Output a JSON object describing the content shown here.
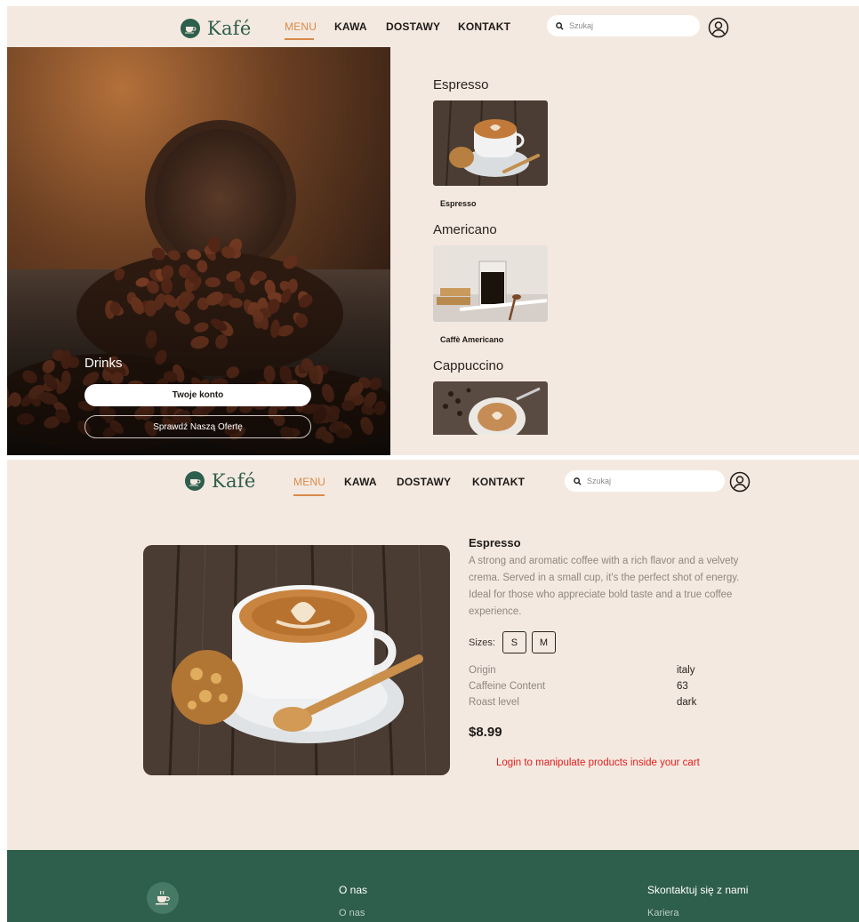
{
  "brand": {
    "name": "Kafé"
  },
  "nav": {
    "items": [
      {
        "label": "MENU",
        "active": true
      },
      {
        "label": "KAWA"
      },
      {
        "label": "DOSTAWY"
      },
      {
        "label": "KONTAKT"
      }
    ],
    "search_placeholder": "Szukaj"
  },
  "hero": {
    "title": "Drinks",
    "primary_button": "Twoje konto",
    "secondary_button": "Sprawdź Naszą Ofertę"
  },
  "menu": {
    "sections": [
      {
        "heading": "Espresso",
        "caption": "Espresso"
      },
      {
        "heading": "Americano",
        "caption": "Caffè Americano"
      },
      {
        "heading": "Cappuccino"
      }
    ]
  },
  "product": {
    "name": "Espresso",
    "description": "A strong and aromatic coffee with a rich flavor and a velvety crema. Served in a small cup, it's the perfect shot of energy. Ideal for those who appreciate bold taste and a true coffee experience.",
    "sizes_label": "Sizes:",
    "sizes": [
      "S",
      "M"
    ],
    "specs": [
      {
        "label": "Origin",
        "value": "italy"
      },
      {
        "label": "Caffeine Content",
        "value": "63"
      },
      {
        "label": "Roast level",
        "value": "dark"
      }
    ],
    "price": "$8.99",
    "login_note": "Login to manipulate products inside your cart"
  },
  "footer": {
    "col1_heading": "O nas",
    "col1_link": "O nas",
    "col2_heading": "Skontaktuj się z nami",
    "col2_link": "Kariera"
  },
  "colors": {
    "background": "#f4e9e0",
    "brand_green": "#2e5e4c",
    "accent": "#d98a4a",
    "error": "#e02020"
  },
  "icons": [
    "logo-cup-icon",
    "search-icon",
    "user-icon"
  ]
}
